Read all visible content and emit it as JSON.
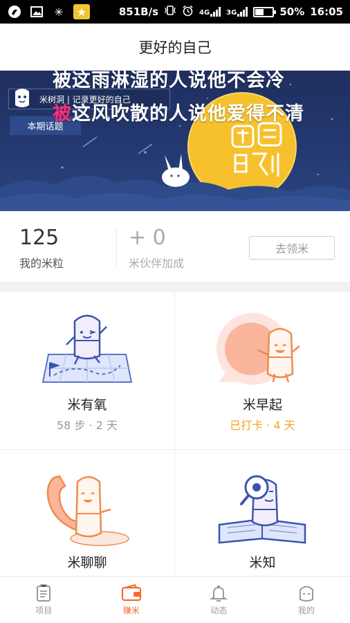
{
  "status_bar": {
    "net_speed": "851B/s",
    "net1": "4G",
    "net2": "3G",
    "battery_pct": "50%",
    "battery_level": 0.5,
    "time": "16:05"
  },
  "title": "更好的自己",
  "banner": {
    "tag_text": "米树洞 | 记录更好的自己",
    "topic_button": "本期话题",
    "line1": "被这雨淋湿的人说他不会冷",
    "line2_highlight": "被",
    "line2_rest": "这风吹散的人说他爱得不清",
    "moon_art_text": "团圆时刻"
  },
  "stats": {
    "rice_count": "125",
    "rice_label": "我的米粒",
    "partner_bonus": "+ 0",
    "partner_label": "米伙伴加成",
    "claim_button": "去领米"
  },
  "cards": [
    {
      "title": "米有氧",
      "subtitle": "58 步 · 2 天",
      "icon": "walking-map-icon"
    },
    {
      "title": "米早起",
      "subtitle": "已打卡 · 4 天",
      "icon": "sunrise-icon"
    },
    {
      "title": "米聊聊",
      "subtitle": "",
      "icon": "phone-chat-icon"
    },
    {
      "title": "米知",
      "subtitle": "",
      "icon": "book-magnifier-icon"
    }
  ],
  "tabs": [
    {
      "label": "项目",
      "icon": "clipboard-icon",
      "active": false
    },
    {
      "label": "赚米",
      "icon": "wallet-icon",
      "active": true
    },
    {
      "label": "动态",
      "icon": "bell-icon",
      "active": false
    },
    {
      "label": "我的",
      "icon": "profile-icon",
      "active": false
    }
  ],
  "colors": {
    "accent": "#f26a2b",
    "checkin_orange": "#f5a623",
    "banner_bg": "#243a72",
    "moon": "#f6c12c",
    "highlight_pink": "#ff2e7a"
  }
}
